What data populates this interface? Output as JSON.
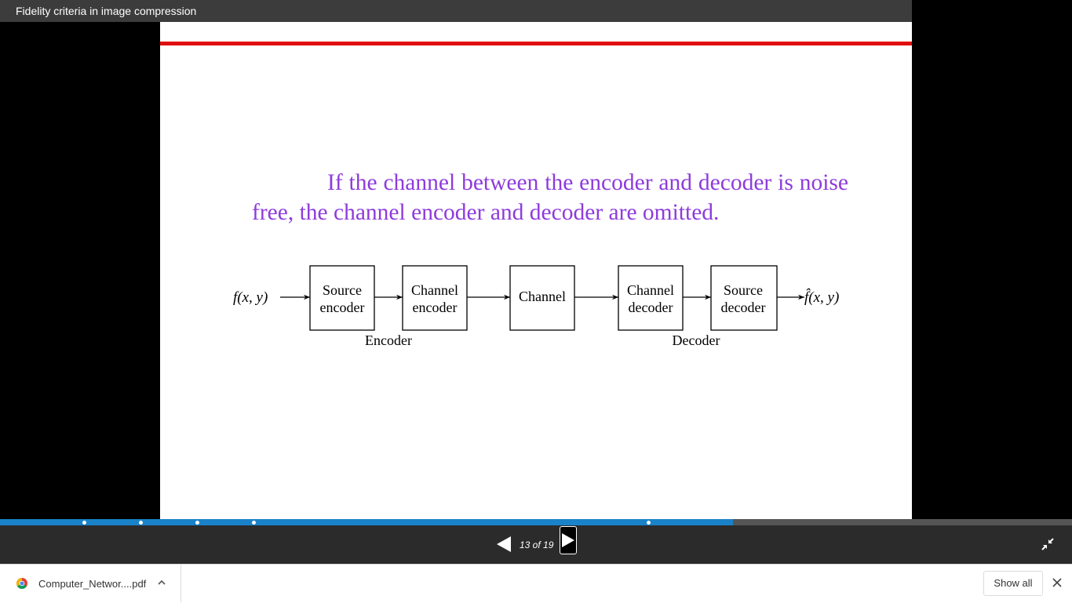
{
  "window": {
    "title": "Fidelity criteria in image compression"
  },
  "slide": {
    "text_line1": "If the channel between the encoder and decoder is",
    "text_line2": "noise free, the channel encoder and decoder are omitted.",
    "text_color": "#8e3bdc",
    "divider_color": "#e01010",
    "diagram": {
      "input_label": "f(x, y)",
      "output_label": "f̂(x, y)",
      "blocks": [
        {
          "line1": "Source",
          "line2": "encoder"
        },
        {
          "line1": "Channel",
          "line2": "encoder"
        },
        {
          "line1": "Channel",
          "line2": ""
        },
        {
          "line1": "Channel",
          "line2": "decoder"
        },
        {
          "line1": "Source",
          "line2": "decoder"
        }
      ],
      "group_encoder": "Encoder",
      "group_decoder": "Decoder"
    }
  },
  "viewer": {
    "progress_fraction": 0.684,
    "progress_color": "#1a82c8",
    "prev_icon": "triangle-left-icon",
    "next_icon": "triangle-right-icon",
    "page_indicator": "13 of 19",
    "exit_fullscreen_icon": "compress-arrows-icon"
  },
  "download_bar": {
    "file_name": "Computer_Networ....pdf",
    "file_icon": "chrome-icon",
    "show_all_label": "Show all",
    "close_icon": "close-icon"
  }
}
